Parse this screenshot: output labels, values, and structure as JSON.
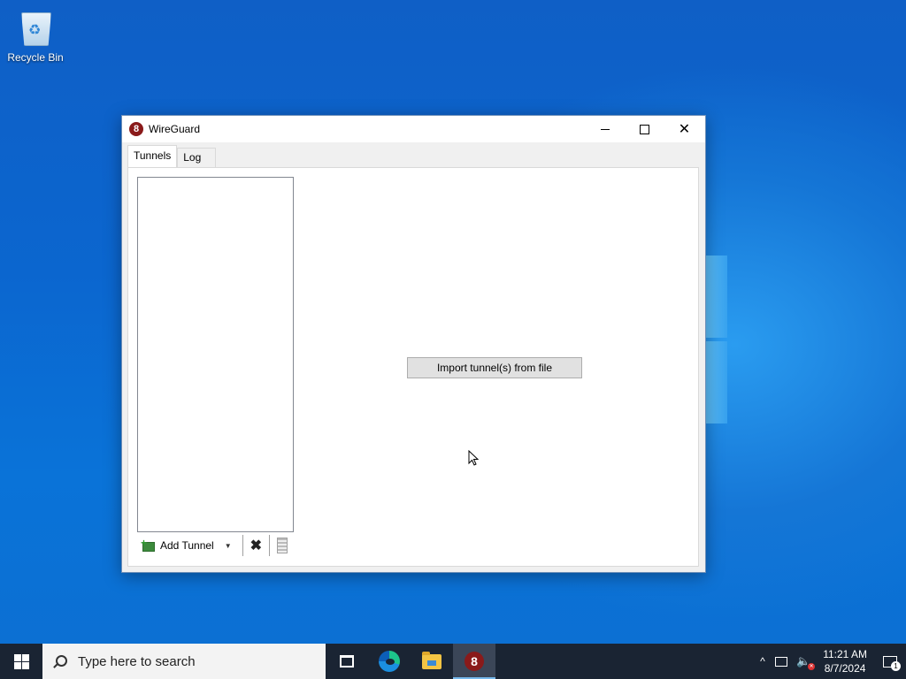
{
  "desktop": {
    "recycle_bin_label": "Recycle Bin"
  },
  "window": {
    "title": "WireGuard",
    "app_icon_glyph": "8",
    "minimize_glyph": "",
    "close_glyph": "✕",
    "tabs": [
      {
        "label": "Tunnels",
        "active": true
      },
      {
        "label": "Log",
        "active": false
      }
    ],
    "toolbar": {
      "add_tunnel_label": "Add Tunnel",
      "dropdown_glyph": "▼",
      "delete_glyph": "✖"
    },
    "import_button_label": "Import tunnel(s) from file"
  },
  "taskbar": {
    "search_placeholder": "Type here to search",
    "apps": [
      {
        "name": "task-view",
        "icon": "task-view-icon"
      },
      {
        "name": "edge",
        "icon": "edge-icon"
      },
      {
        "name": "file-explorer",
        "icon": "folder-icon"
      },
      {
        "name": "wireguard",
        "icon": "wireguard-icon",
        "active": true
      }
    ],
    "tray": {
      "chevron_glyph": "^",
      "volume_glyph": "🔈",
      "time": "11:21 AM",
      "date": "8/7/2024",
      "notification_count": "1"
    }
  },
  "colors": {
    "taskbar_bg": "#1a2433",
    "active_indicator": "#76b9ed",
    "wireguard_red": "#8a1a1a"
  }
}
